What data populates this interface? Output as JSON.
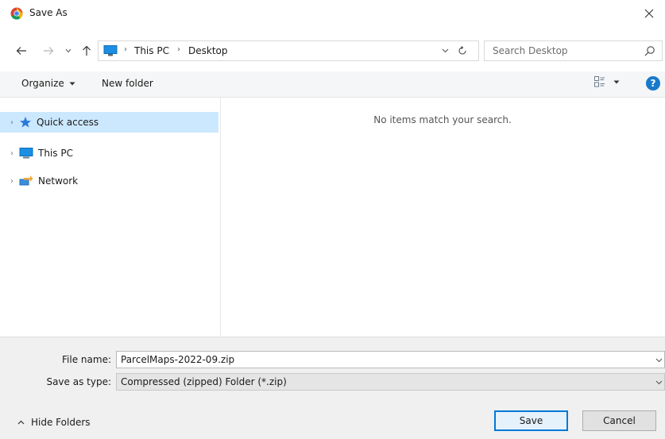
{
  "window": {
    "title": "Save As"
  },
  "nav": {
    "breadcrumbs": [
      "This PC",
      "Desktop"
    ],
    "search_placeholder": "Search Desktop"
  },
  "toolbar": {
    "organize_label": "Organize",
    "new_folder_label": "New folder"
  },
  "sidebar": {
    "items": [
      {
        "label": "Quick access",
        "selected": true
      },
      {
        "label": "This PC",
        "selected": false
      },
      {
        "label": "Network",
        "selected": false
      }
    ]
  },
  "content": {
    "empty_message": "No items match your search."
  },
  "form": {
    "file_name_label": "File name:",
    "file_name_value": "ParcelMaps-2022-09.zip",
    "save_as_type_label": "Save as type:",
    "save_as_type_value": "Compressed (zipped) Folder (*.zip)"
  },
  "buttons": {
    "save_label": "Save",
    "cancel_label": "Cancel",
    "hide_folders_label": "Hide Folders"
  },
  "colors": {
    "selection": "#cce8ff",
    "accent": "#0078d7",
    "help": "#1979ca"
  }
}
